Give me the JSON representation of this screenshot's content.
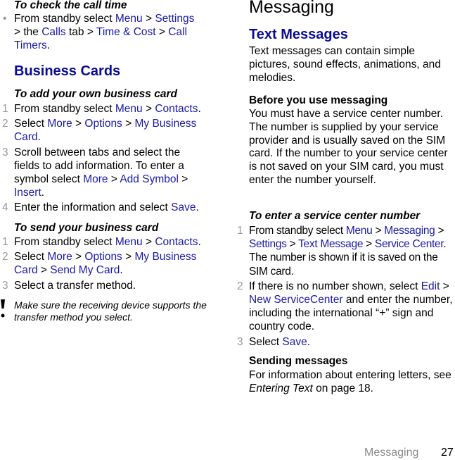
{
  "left": {
    "check_call_time": {
      "heading": "To check the call time",
      "text_1": "From standby select ",
      "menu": "Menu",
      "sep": " > ",
      "settings": "Settings",
      "text_2": "> the ",
      "calls": "Calls",
      "text_3": " tab > ",
      "time_cost": "Time & Cost",
      "call_timers": "Call Timers",
      "end": "."
    },
    "business_cards": {
      "heading": "Business Cards",
      "add": {
        "heading": "To add your own business card",
        "steps": [
          {
            "num": "1",
            "t1": "From standby select ",
            "l1": "Menu",
            "s": " > ",
            "l2": "Contacts",
            "end": "."
          },
          {
            "num": "2",
            "t1": "Select ",
            "l1": "More",
            "l2": "Options",
            "l3": "My Business Card",
            "end": "."
          },
          {
            "num": "3",
            "t1": "Scroll between tabs and select the fields to add information. To enter a symbol select ",
            "l1": "More",
            "l2": "Add Symbol",
            "l3": "Insert",
            "end": "."
          },
          {
            "num": "4",
            "t1": "Enter the information and select ",
            "l1": "Save",
            "end": "."
          }
        ]
      },
      "send": {
        "heading": "To send your business card",
        "steps": [
          {
            "num": "1",
            "t1": "From standby select ",
            "l1": "Menu",
            "l2": "Contacts",
            "end": "."
          },
          {
            "num": "2",
            "t1": "Select ",
            "l1": "More",
            "l2": "Options",
            "l3": "My Business Card",
            "l4": "Send My Card",
            "end": "."
          },
          {
            "num": "3",
            "t1": "Select a transfer method."
          }
        ]
      },
      "note": "Make sure the receiving device supports the transfer method you select."
    }
  },
  "right": {
    "title": "Messaging",
    "text_messages": {
      "heading": "Text Messages",
      "intro": "Text messages can contain simple pictures, sound effects, animations, and melodies.",
      "before_heading": "Before you use messaging",
      "before_text": "You must have a service center number. The number is supplied by your service provider and is usually saved on the SIM card. If the number to your service center is not saved on your SIM card, you must enter the number yourself.",
      "enter": {
        "heading": "To enter a service center number",
        "steps": [
          {
            "num": "1",
            "t1": "From standby select ",
            "l1": "Menu",
            "l2": "Messaging",
            "l3": "Settings",
            "l4": "Text Message",
            "l5": "Service Center",
            "t2": ". The number is shown if it is saved on the SIM card."
          },
          {
            "num": "2",
            "t1": "If there is no number shown, select ",
            "l1": "Edit",
            "l2": "New ServiceCenter",
            "t2": " and enter the number, including the international “+” sign and country code."
          },
          {
            "num": "3",
            "t1": "Select ",
            "l1": "Save",
            "end": "."
          }
        ]
      },
      "sending_heading": "Sending messages",
      "sending_t1": "For information about entering letters, see ",
      "sending_ref": "Entering Text",
      "sending_t2": " on page 18."
    }
  },
  "footer": {
    "section": "Messaging",
    "page": "27"
  }
}
